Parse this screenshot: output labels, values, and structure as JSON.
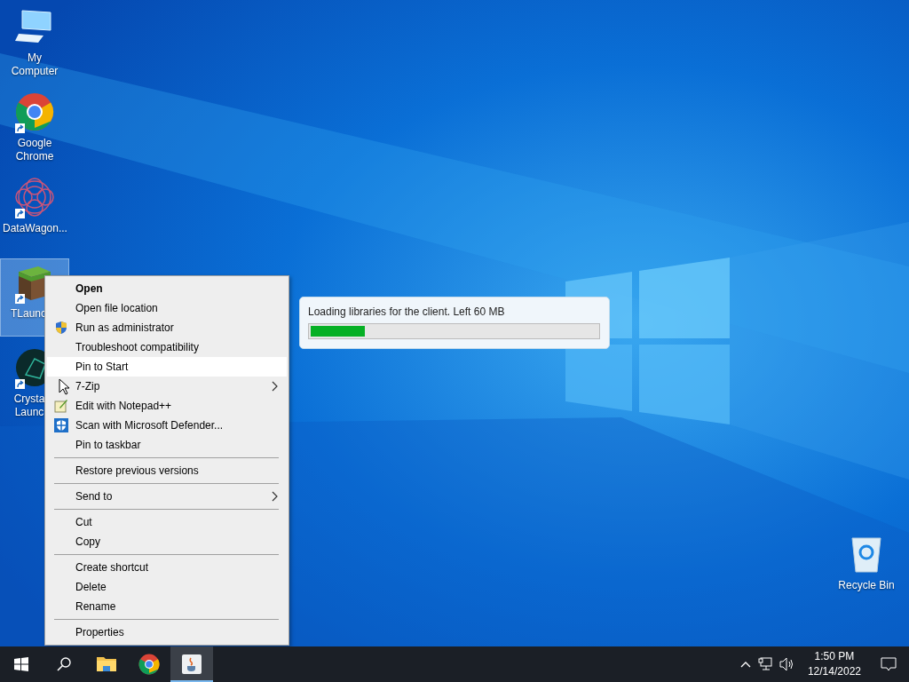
{
  "desktop_icons": [
    {
      "label": "My Computer",
      "kind": "computer",
      "shortcut": false,
      "selected": false
    },
    {
      "label": "Google Chrome",
      "kind": "chrome",
      "shortcut": true,
      "selected": false
    },
    {
      "label": "DataWagon...",
      "kind": "datawagon",
      "shortcut": true,
      "selected": false
    },
    {
      "label": "TLaunc",
      "kind": "tlauncher",
      "shortcut": true,
      "selected": true
    },
    {
      "label": "Crysta Launc",
      "kind": "crystal",
      "shortcut": true,
      "selected": false
    }
  ],
  "recycle_bin": {
    "label": "Recycle Bin"
  },
  "context_menu": {
    "groups": [
      [
        {
          "label": "Open",
          "default": true,
          "kind": "plain",
          "submenu": false,
          "selected": false
        },
        {
          "label": "Open file location",
          "default": false,
          "kind": "plain",
          "submenu": false,
          "selected": false
        },
        {
          "label": "Run as administrator",
          "default": false,
          "kind": "shield",
          "submenu": false,
          "selected": false
        },
        {
          "label": "Troubleshoot compatibility",
          "default": false,
          "kind": "plain",
          "submenu": false,
          "selected": false
        },
        {
          "label": "Pin to Start",
          "default": false,
          "kind": "plain",
          "submenu": false,
          "selected": true
        },
        {
          "label": "7-Zip",
          "default": false,
          "kind": "plain",
          "submenu": true,
          "selected": false
        },
        {
          "label": "Edit with Notepad++",
          "default": false,
          "kind": "notepad",
          "submenu": false,
          "selected": false
        },
        {
          "label": "Scan with Microsoft Defender...",
          "default": false,
          "kind": "defender",
          "submenu": false,
          "selected": false
        },
        {
          "label": "Pin to taskbar",
          "default": false,
          "kind": "plain",
          "submenu": false,
          "selected": false
        }
      ],
      [
        {
          "label": "Restore previous versions",
          "default": false,
          "kind": "plain",
          "submenu": false,
          "selected": false
        }
      ],
      [
        {
          "label": "Send to",
          "default": false,
          "kind": "plain",
          "submenu": true,
          "selected": false
        }
      ],
      [
        {
          "label": "Cut",
          "default": false,
          "kind": "plain",
          "submenu": false,
          "selected": false
        },
        {
          "label": "Copy",
          "default": false,
          "kind": "plain",
          "submenu": false,
          "selected": false
        }
      ],
      [
        {
          "label": "Create shortcut",
          "default": false,
          "kind": "plain",
          "submenu": false,
          "selected": false
        },
        {
          "label": "Delete",
          "default": false,
          "kind": "plain",
          "submenu": false,
          "selected": false
        },
        {
          "label": "Rename",
          "default": false,
          "kind": "plain",
          "submenu": false,
          "selected": false
        }
      ],
      [
        {
          "label": "Properties",
          "default": false,
          "kind": "plain",
          "submenu": false,
          "selected": false
        }
      ]
    ]
  },
  "progress_dialog": {
    "message": "Loading libraries for the client. Left 60 MB",
    "level": 0.19
  },
  "taskbar": {
    "apps": [
      {
        "kind": "explorer",
        "active": false
      },
      {
        "kind": "chrome",
        "active": false
      },
      {
        "kind": "java",
        "active": true
      }
    ],
    "time": "1:50 PM",
    "date": "12/14/2022"
  }
}
